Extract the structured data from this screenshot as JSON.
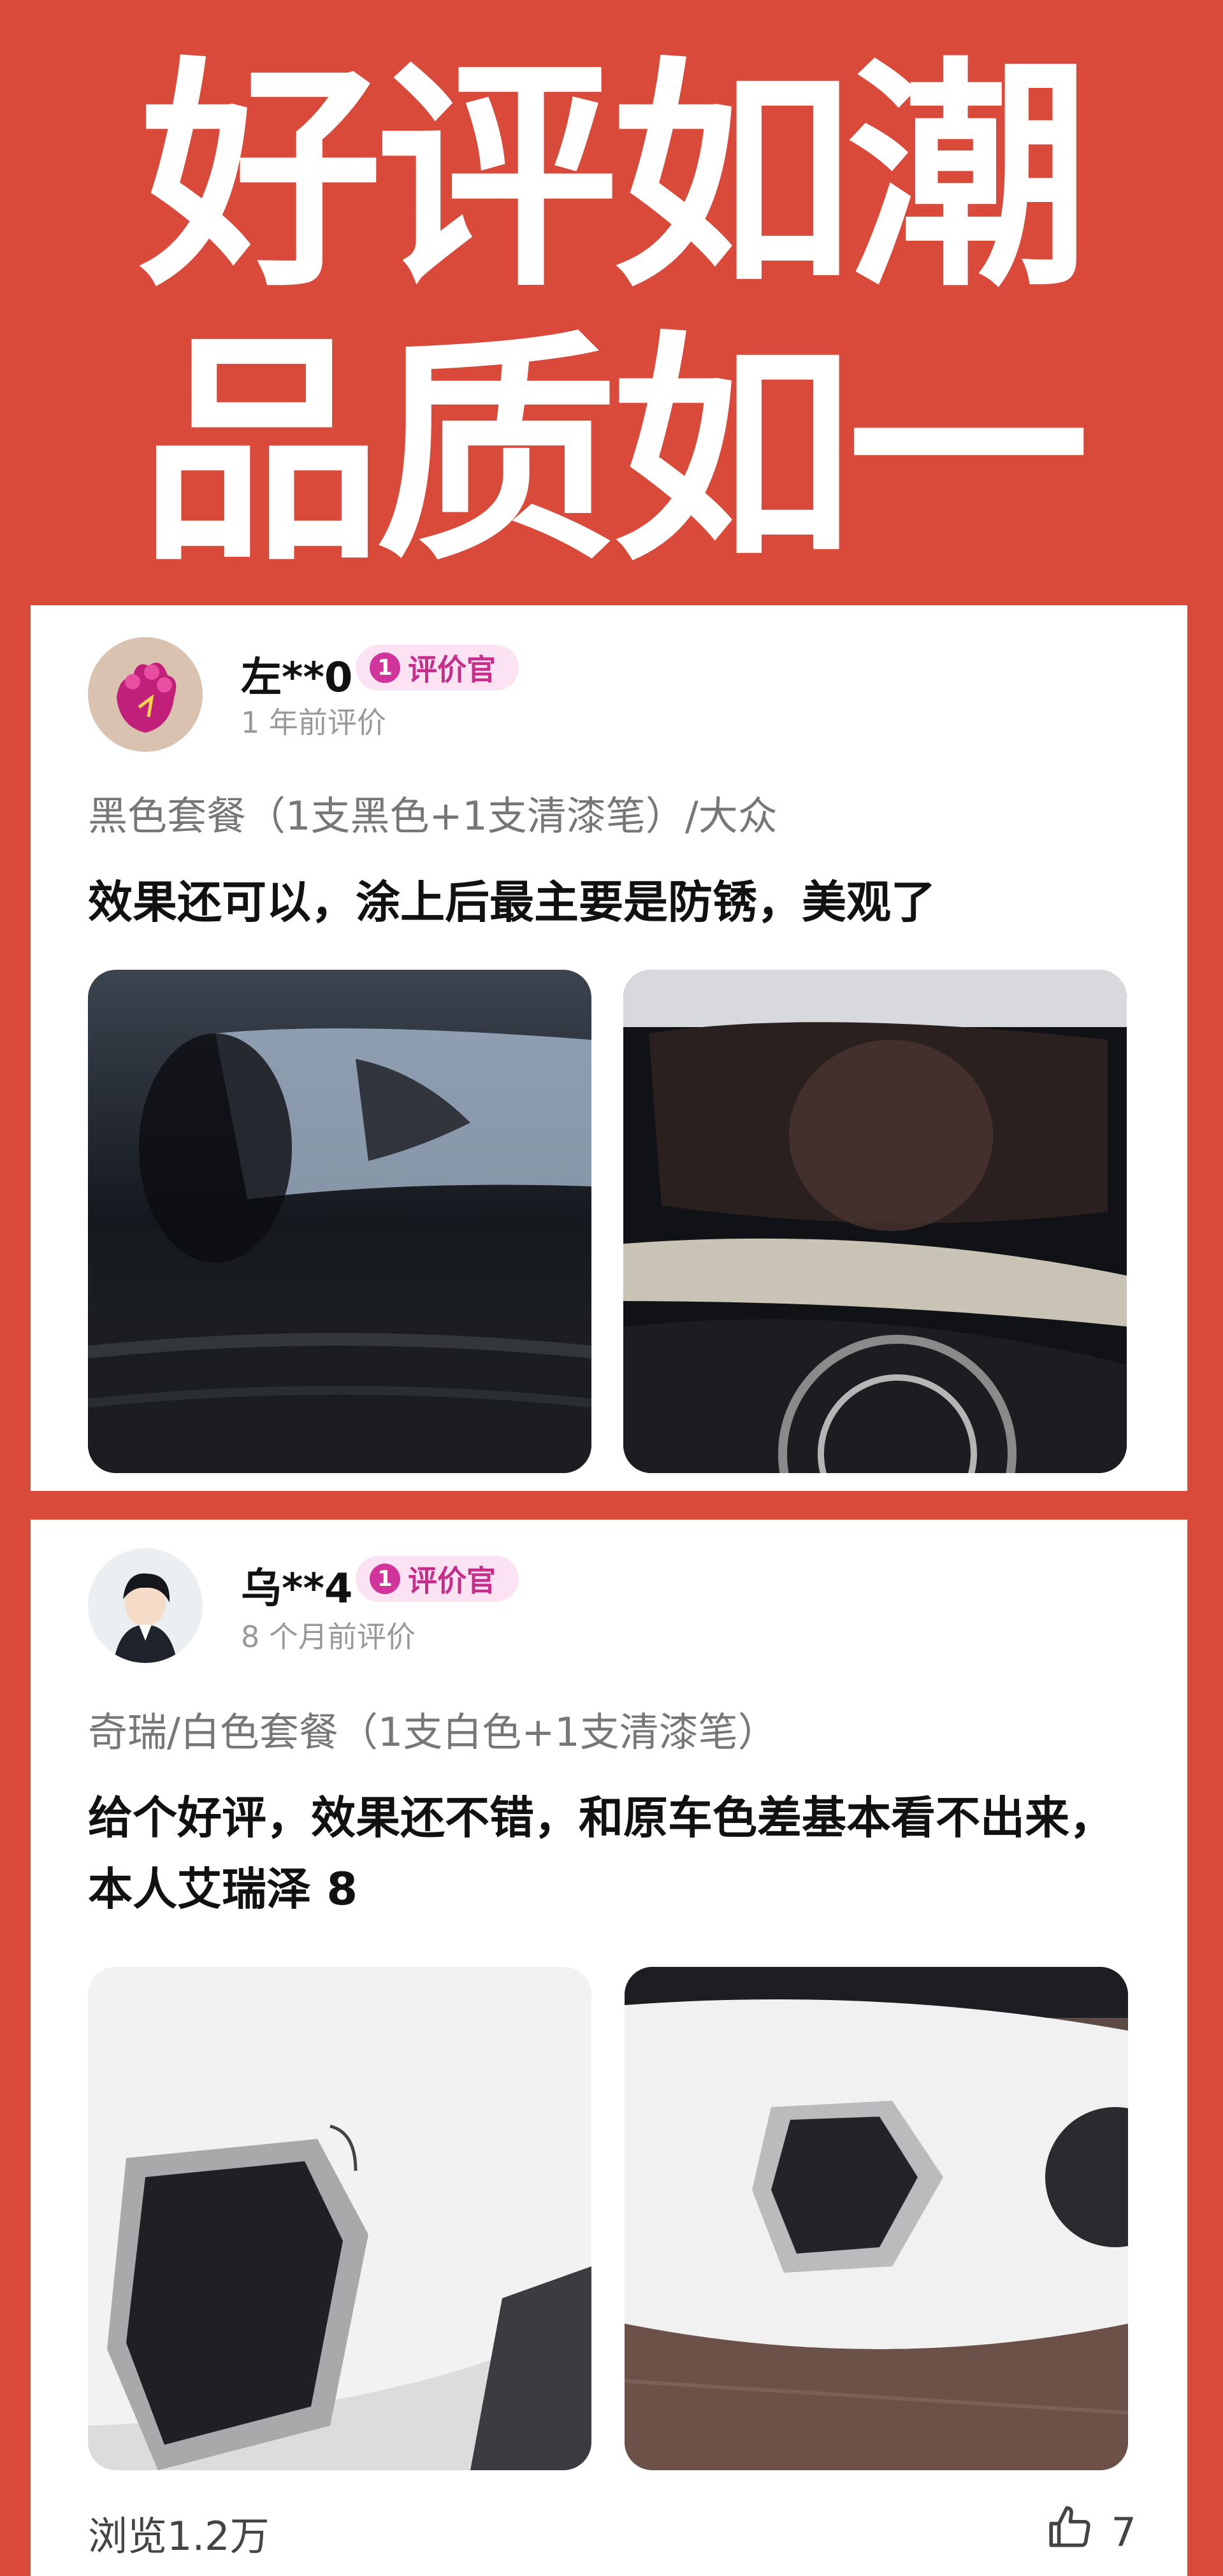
{
  "headline": {
    "line1": "好评如潮",
    "line2": "品质如一"
  },
  "reviews": [
    {
      "username": "左**0",
      "badge_number": "1",
      "badge_label": "评价官",
      "time": "1 年前评价",
      "variant": "黑色套餐（1支黑色+1支清漆笔）/大众",
      "text": "效果还可以，涂上后最主要是防锈，美观了"
    },
    {
      "username": "乌**4",
      "badge_number": "1",
      "badge_label": "评价官",
      "time": "8 个月前评价",
      "variant": "奇瑞/白色套餐（1支白色+1支清漆笔）",
      "text": "给个好评，效果还不错，和原车色差基本看不出来，本人艾瑞泽 8"
    }
  ],
  "footer": {
    "views": "浏览1.2万",
    "likes": "7",
    "like_icon": "thumbs-up-icon"
  },
  "colors": {
    "background": "#d94a3b",
    "badge_bg": "#fbe3f3",
    "badge_accent": "#d1349a"
  }
}
